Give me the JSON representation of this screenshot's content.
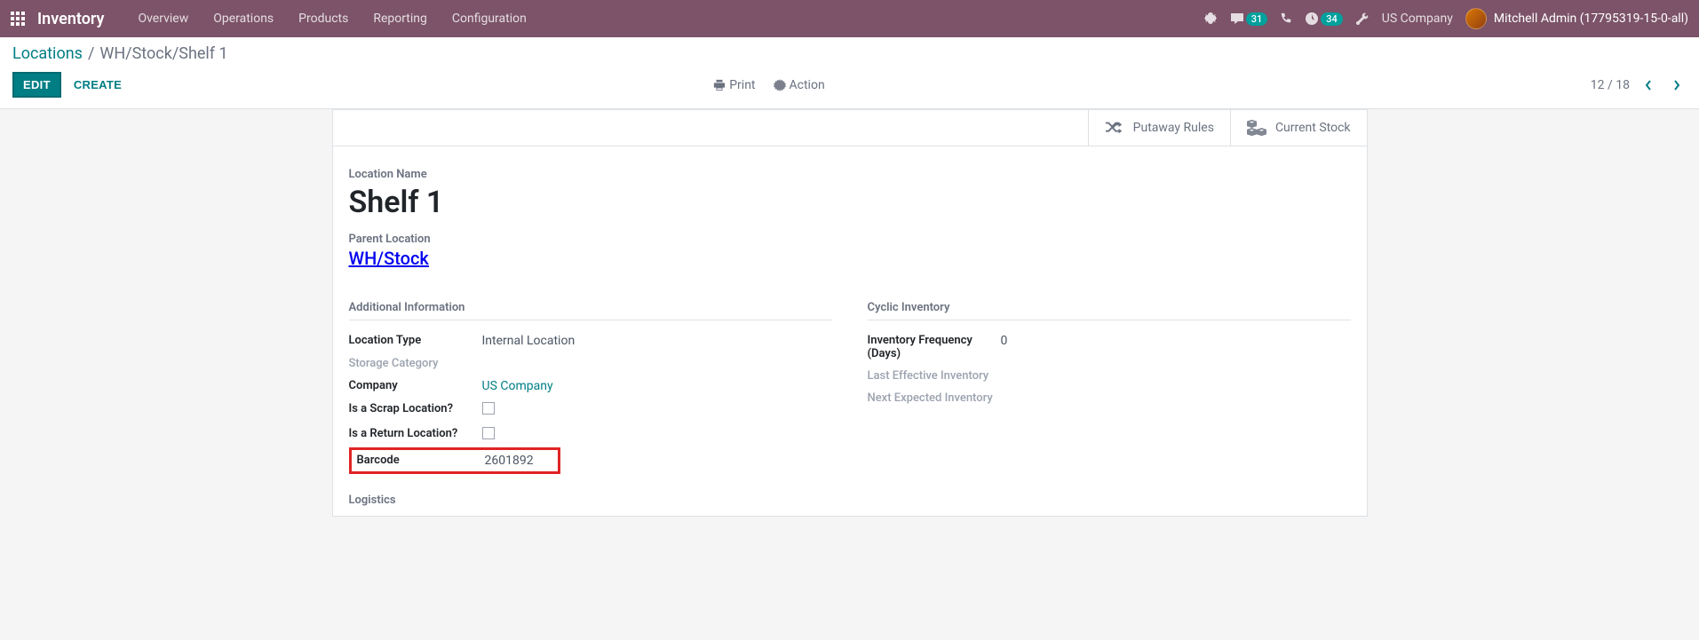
{
  "navbar": {
    "brand": "Inventory",
    "menu": [
      "Overview",
      "Operations",
      "Products",
      "Reporting",
      "Configuration"
    ],
    "messages_badge": "31",
    "activities_badge": "34",
    "company": "US Company",
    "user": "Mitchell Admin (17795319-15-0-all)"
  },
  "breadcrumb": {
    "root": "Locations",
    "sep": "/",
    "current": "WH/Stock/Shelf 1"
  },
  "cp": {
    "edit": "EDIT",
    "create": "CREATE",
    "print": "Print",
    "action": "Action",
    "pager": "12 / 18"
  },
  "buttonbox": {
    "putaway": "Putaway Rules",
    "stock": "Current Stock"
  },
  "form": {
    "location_name_label": "Location Name",
    "location_name": "Shelf 1",
    "parent_label": "Parent Location",
    "parent_value": "WH/Stock",
    "additional_info": "Additional Information",
    "location_type_label": "Location Type",
    "location_type_value": "Internal Location",
    "storage_category_label": "Storage Category",
    "company_label": "Company",
    "company_value": "US Company",
    "scrap_label": "Is a Scrap Location?",
    "return_label": "Is a Return Location?",
    "barcode_label": "Barcode",
    "barcode_value": "2601892",
    "cyclic_inventory": "Cyclic Inventory",
    "freq_label": "Inventory Frequency (Days)",
    "freq_value": "0",
    "last_eff_label": "Last Effective Inventory",
    "next_exp_label": "Next Expected Inventory",
    "logistics": "Logistics"
  }
}
